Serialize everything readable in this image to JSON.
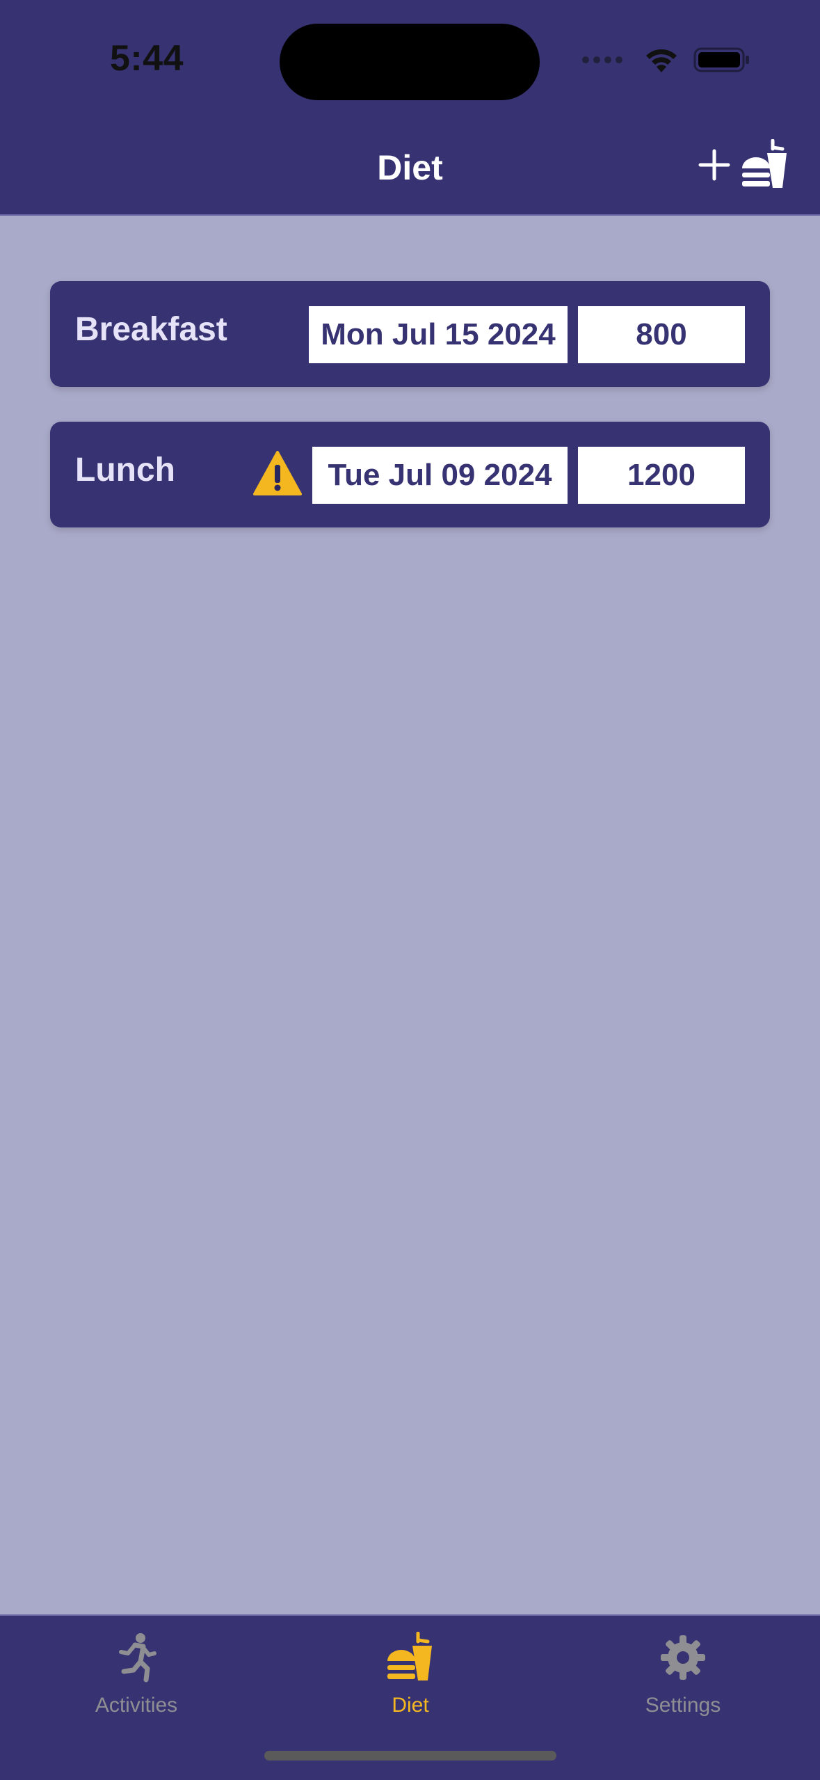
{
  "status_bar": {
    "time": "5:44"
  },
  "nav": {
    "title": "Diet"
  },
  "entries": [
    {
      "meal": "Breakfast",
      "date": "Mon Jul 15 2024",
      "calories": "800",
      "warning": false
    },
    {
      "meal": "Lunch",
      "date": "Tue Jul 09 2024",
      "calories": "1200",
      "warning": true
    }
  ],
  "tabs": [
    {
      "label": "Activities",
      "icon": "running-person-icon",
      "active": false
    },
    {
      "label": "Diet",
      "icon": "burger-drink-icon",
      "active": true
    },
    {
      "label": "Settings",
      "icon": "gear-icon",
      "active": false
    }
  ],
  "colors": {
    "header_bg": "#373373",
    "page_bg": "#a9a9c9",
    "accent_active": "#f4b71f",
    "tab_inactive": "#8e8e93",
    "warning": "#f4b71f"
  }
}
